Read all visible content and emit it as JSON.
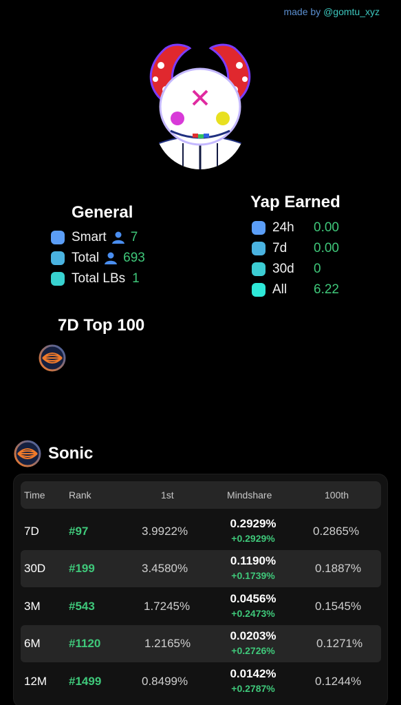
{
  "credit": {
    "prefix": "made by",
    "handle": "@gomtu_xyz"
  },
  "general": {
    "title": "General",
    "items": [
      {
        "label": "Smart",
        "icon": "person-icon",
        "value": "7",
        "color": "#5b9ef7"
      },
      {
        "label": "Total",
        "icon": "person-icon",
        "value": "693",
        "color": "#4ab3e0"
      },
      {
        "label": "Total LBs",
        "value": "1",
        "color": "#38d2d0"
      }
    ]
  },
  "yap": {
    "title": "Yap Earned",
    "items": [
      {
        "label": "24h",
        "value": "0.00",
        "color": "#5b9ef7"
      },
      {
        "label": "7d",
        "value": "0.00",
        "color": "#4ab3e0"
      },
      {
        "label": "30d",
        "value": "0",
        "color": "#3ccdd3"
      },
      {
        "label": "All",
        "value": "6.22",
        "color": "#2ee8d8"
      }
    ]
  },
  "top100": {
    "title": "7D Top 100"
  },
  "project": {
    "name": "Sonic"
  },
  "table": {
    "headers": {
      "time": "Time",
      "rank": "Rank",
      "first": "1st",
      "mindshare": "Mindshare",
      "hundredth": "100th"
    },
    "rows": [
      {
        "time": "7D",
        "rank": "#97",
        "first": "3.9922%",
        "mindshare": "0.2929%",
        "delta": "+0.2929%",
        "hundredth": "0.2865%"
      },
      {
        "time": "30D",
        "rank": "#199",
        "first": "3.4580%",
        "mindshare": "0.1190%",
        "delta": "+0.1739%",
        "hundredth": "0.1887%"
      },
      {
        "time": "3M",
        "rank": "#543",
        "first": "1.7245%",
        "mindshare": "0.0456%",
        "delta": "+0.2473%",
        "hundredth": "0.1545%"
      },
      {
        "time": "6M",
        "rank": "#1120",
        "first": "1.2165%",
        "mindshare": "0.0203%",
        "delta": "+0.2726%",
        "hundredth": "0.1271%"
      },
      {
        "time": "12M",
        "rank": "#1499",
        "first": "0.8499%",
        "mindshare": "0.0142%",
        "delta": "+0.2787%",
        "hundredth": "0.1244%"
      }
    ]
  },
  "colors": {
    "green": "#3fc87a",
    "accent_blue": "#5b8fd0",
    "accent_teal": "#3dc9c0"
  }
}
